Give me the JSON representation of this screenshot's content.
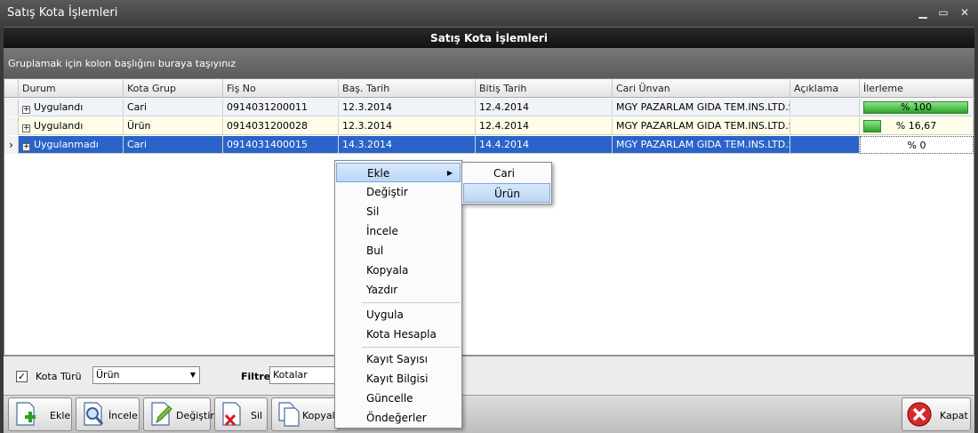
{
  "window": {
    "title": "Satış Kota İşlemleri"
  },
  "header": {
    "title": "Satış Kota İşlemleri"
  },
  "group_panel": {
    "hint": "Gruplamak için kolon başlığını buraya taşıyınız"
  },
  "columns": [
    "Durum",
    "Kota Grup",
    "Fiş No",
    "Baş. Tarih",
    "Bitiş Tarih",
    "Cari Ünvan",
    "Açıklama",
    "İlerleme"
  ],
  "rows": [
    {
      "durum": "Uygulandı",
      "kota_grup": "Cari",
      "fis_no": "0914031200011",
      "bas_tarih": "12.3.2014",
      "bitis_tarih": "12.4.2014",
      "cari_unvan": "MGY PAZARLAM GIDA TEM.INS.LTD.S...",
      "aciklama": "",
      "progress": 100,
      "progress_label": "% 100"
    },
    {
      "durum": "Uygulandı",
      "kota_grup": "Ürün",
      "fis_no": "0914031200028",
      "bas_tarih": "12.3.2014",
      "bitis_tarih": "12.4.2014",
      "cari_unvan": "MGY PAZARLAM GIDA TEM.INS.LTD.S...",
      "aciklama": "",
      "progress": 16.67,
      "progress_label": "% 16,67"
    },
    {
      "durum": "Uygulanmadı",
      "kota_grup": "Cari",
      "fis_no": "0914031400015",
      "bas_tarih": "14.3.2014",
      "bitis_tarih": "14.4.2014",
      "cari_unvan": "MGY PAZARLAM GIDA TEM.INS.LTD.S...",
      "aciklama": "",
      "progress": 0,
      "progress_label": "% 0"
    }
  ],
  "filters": {
    "kota_turu_label": "Kota Türü",
    "kota_turu_checked": true,
    "kota_turu_value": "Ürün",
    "filtre_label": "Filtre",
    "filtre_value": "Kotalar"
  },
  "toolbar": {
    "ekle": "Ekle",
    "incele": "İncele",
    "degistir": "Değiştir",
    "sil": "Sil",
    "kopyala": "Kopyala",
    "kapat": "Kapat"
  },
  "context_menu": {
    "items": [
      "Ekle",
      "Değiştir",
      "Sil",
      "İncele",
      "Bul",
      "Kopyala",
      "Yazdır",
      "Uygula",
      "Kota Hesapla",
      "Kayıt Sayısı",
      "Kayıt Bilgisi",
      "Güncelle",
      "Öndeğerler"
    ]
  },
  "submenu": {
    "items": [
      "Cari",
      "Ürün"
    ]
  },
  "colors": {
    "selected_row": "#2a63c9",
    "progress_green": "#2ba328"
  }
}
